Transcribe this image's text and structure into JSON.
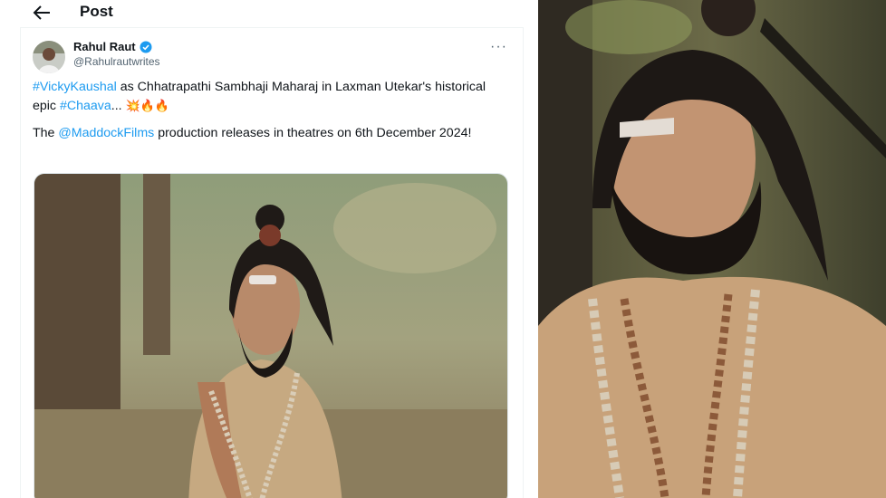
{
  "header": {
    "title": "Post",
    "back_icon": "arrow-left-icon"
  },
  "tweet": {
    "author_name": "Rahul Raut",
    "author_handle": "@Rahulrautwrites",
    "verified_icon": "verified-badge-icon",
    "more_icon": "more-options-icon",
    "text": {
      "hashtag1": "#VickyKaushal",
      "seg1": " as Chhatrapathi Sambhaji Maharaj in Laxman Utekar's historical epic ",
      "hashtag2": "#Chaava",
      "seg2": "... ",
      "emojis": "💥🔥🔥",
      "seg3": "The ",
      "mention": "@MaddockFilms",
      "seg4": " production releases in theatres on 6th December 2024!"
    }
  },
  "colors": {
    "link": "#1d9bf0",
    "text": "#0f1419",
    "secondary": "#536471"
  }
}
